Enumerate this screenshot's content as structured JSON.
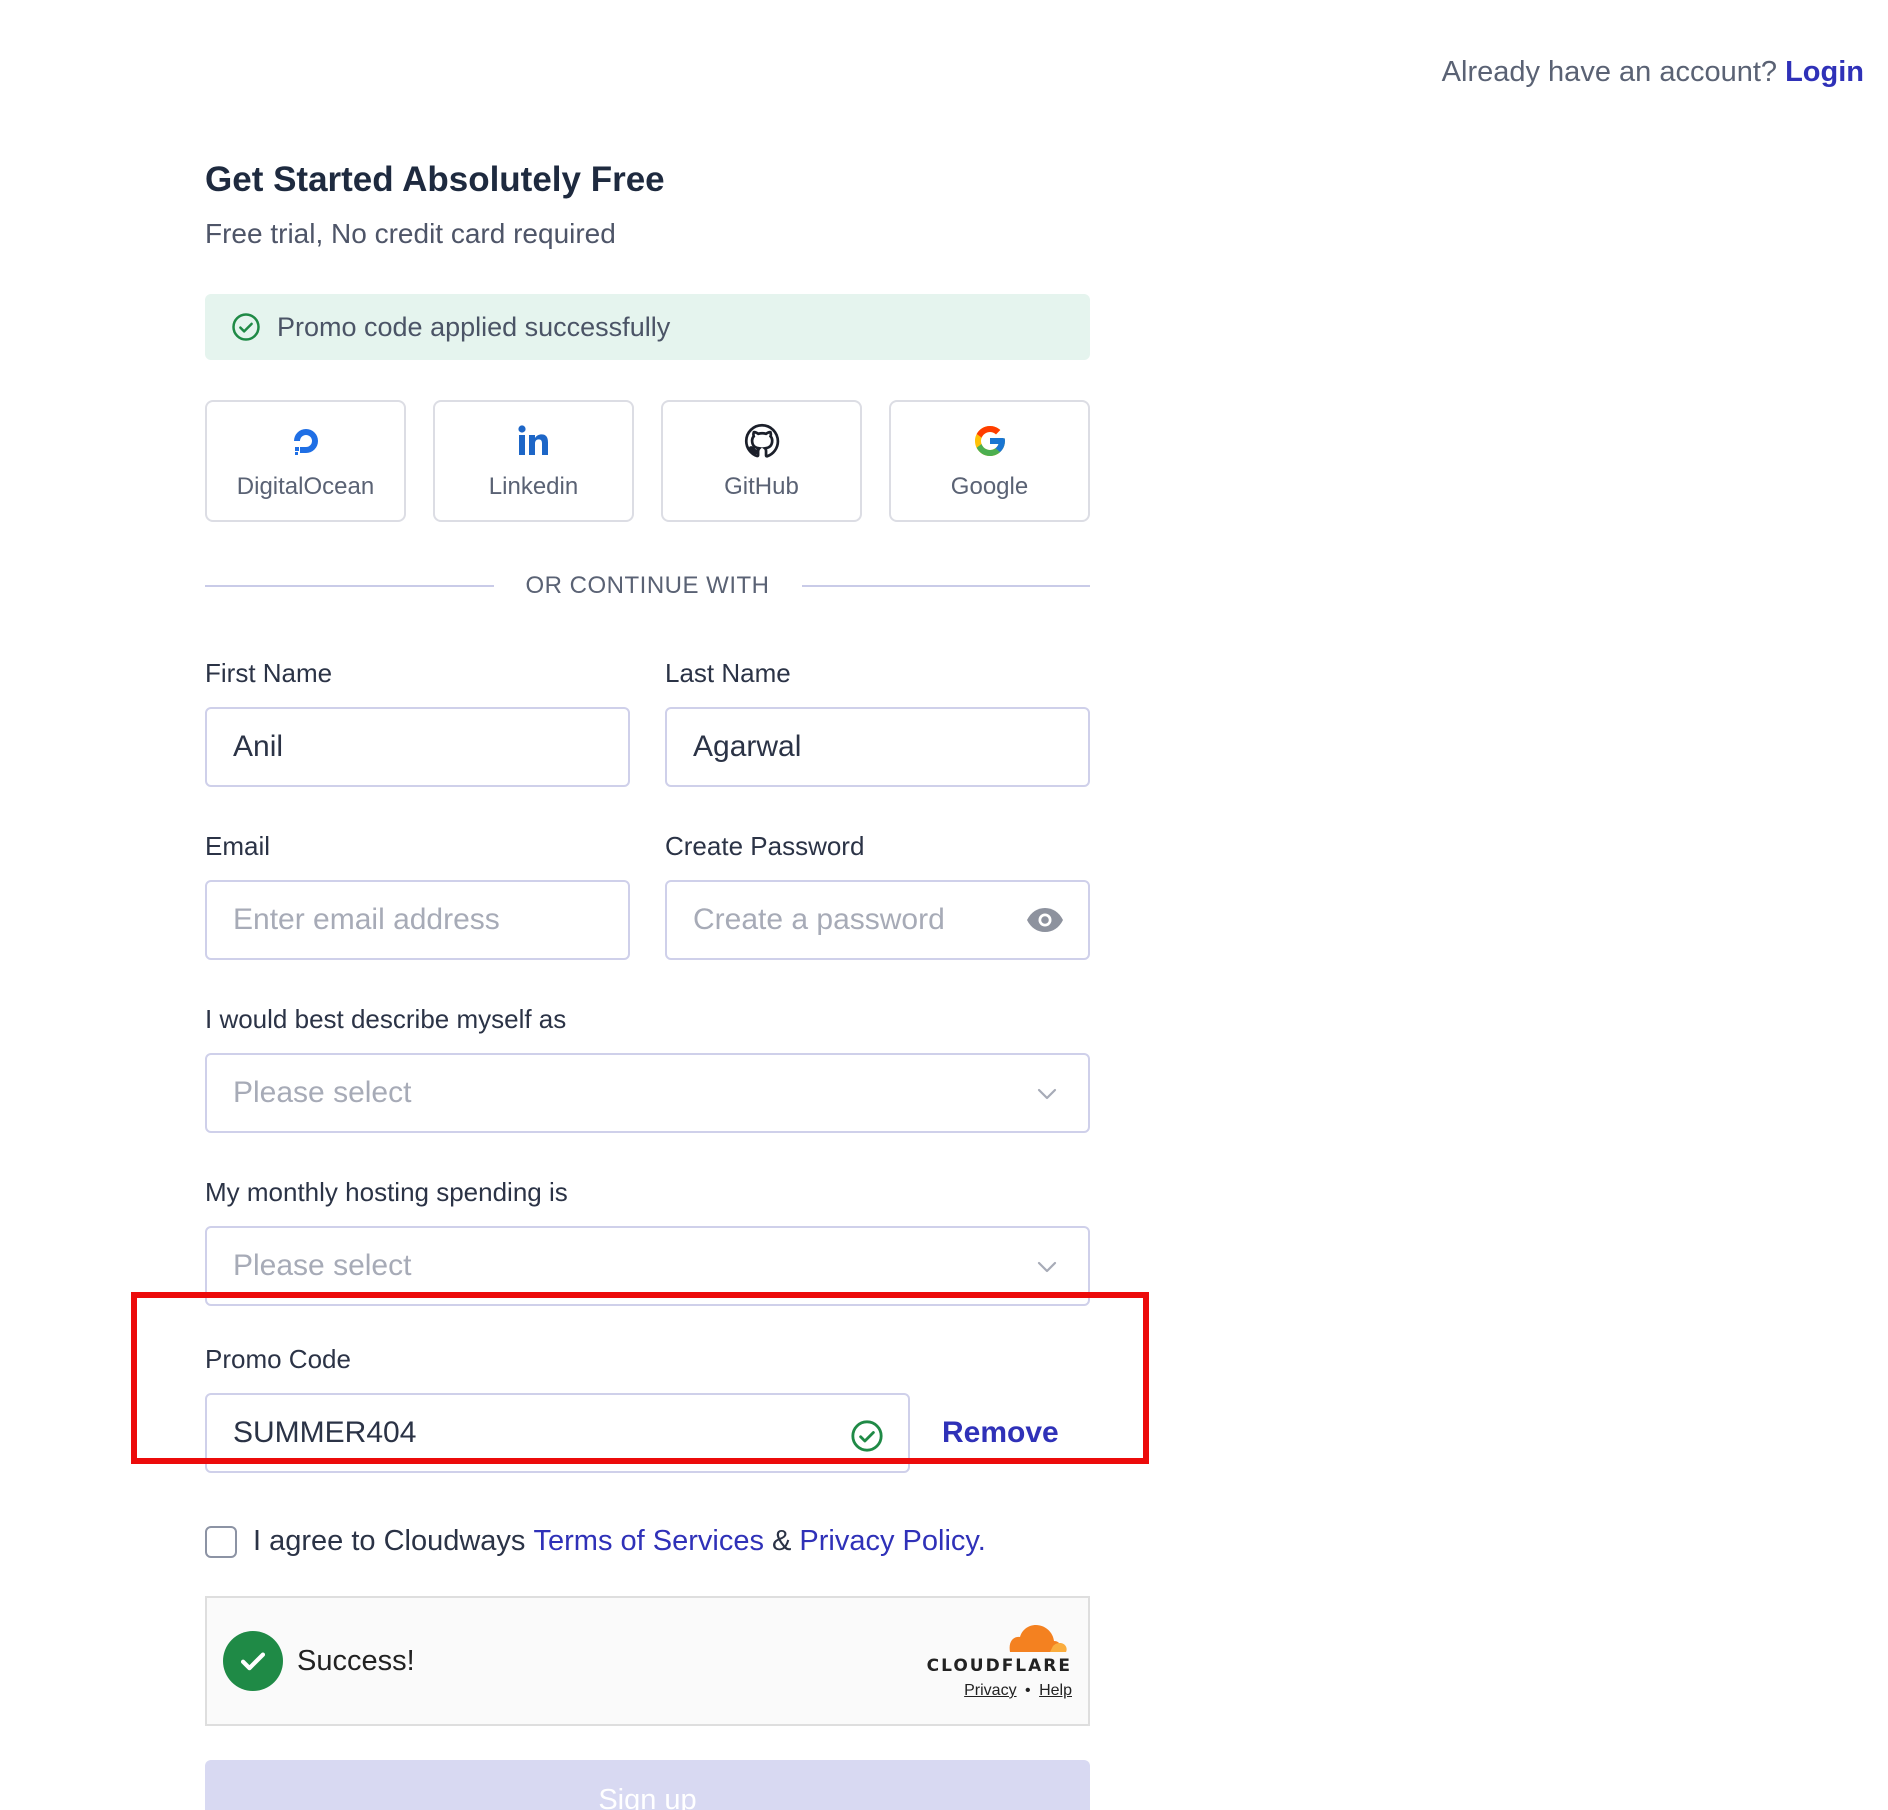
{
  "header": {
    "prompt": "Already have an account?",
    "login_label": "Login"
  },
  "title": "Get Started Absolutely Free",
  "subtitle": "Free trial, No credit card required",
  "promo_banner": {
    "message": "Promo code applied successfully",
    "icon": "check-circle-icon",
    "color": "#e5f4ee"
  },
  "social_buttons": [
    {
      "label": "DigitalOcean",
      "icon": "digitalocean-icon"
    },
    {
      "label": "Linkedin",
      "icon": "linkedin-icon"
    },
    {
      "label": "GitHub",
      "icon": "github-icon"
    },
    {
      "label": "Google",
      "icon": "google-icon"
    }
  ],
  "divider_text": "OR CONTINUE WITH",
  "form": {
    "first_name": {
      "label": "First Name",
      "value": "Anil"
    },
    "last_name": {
      "label": "Last Name",
      "value": "Agarwal"
    },
    "email": {
      "label": "Email",
      "placeholder": "Enter email address"
    },
    "password": {
      "label": "Create Password",
      "placeholder": "Create a password"
    },
    "describe": {
      "label": "I would best describe myself as",
      "selected": "Please select"
    },
    "spending": {
      "label": "My monthly hosting spending is",
      "selected": "Please select"
    },
    "promo": {
      "label": "Promo Code",
      "value": "SUMMER404",
      "remove_label": "Remove"
    }
  },
  "agree": {
    "prefix": "I agree to Cloudways",
    "terms": "Terms of Services",
    "amp": "&",
    "privacy": "Privacy Policy."
  },
  "captcha": {
    "status": "Success!",
    "brand": "CLOUDFLARE",
    "privacy": "Privacy",
    "sep": "•",
    "help": "Help"
  },
  "signup_label": "Sign up",
  "colors": {
    "accent": "#2f31b8",
    "success": "#1f8a46",
    "highlight_border": "#ec0b0b",
    "disabled_button": "#d8d9f2"
  }
}
